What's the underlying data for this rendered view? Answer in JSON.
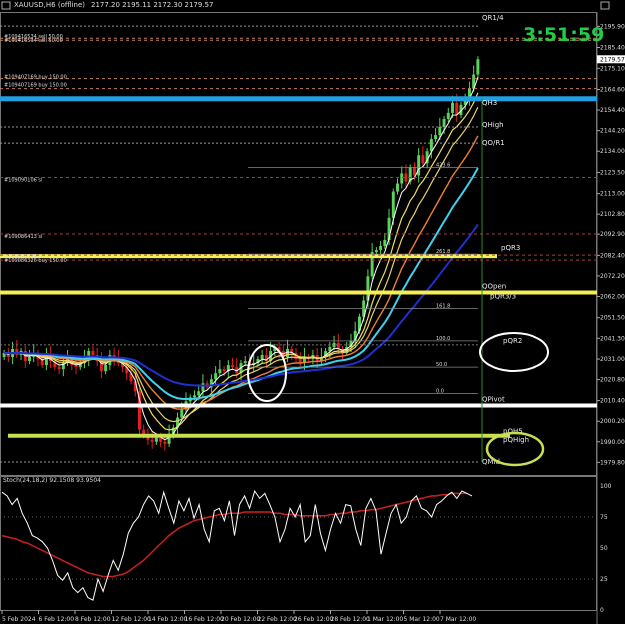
{
  "window": {
    "title": "XAUUSD,H6 (offline)",
    "ohlc": "2177.20 2195.11 2172.30 2179.57",
    "countdown": "3:51:59",
    "current_price_tag": "2179.57"
  },
  "colors": {
    "background": "#000000",
    "bull_candle": "#5ad35a",
    "bear_candle": "#e02020",
    "ema_fast": "#ffffff",
    "ema_yellow": "#f0e060",
    "ema_orange": "#f08030",
    "ema_cyan": "#40d0f0",
    "ema_blue": "#2030d0",
    "countdown": "#22cc44",
    "stoch_main": "#ffffff",
    "stoch_signal": "#cc2020"
  },
  "price_axis": {
    "ticks": [
      "2195.90",
      "2185.40",
      "2175.10",
      "2164.60",
      "2154.40",
      "2144.20",
      "2134.00",
      "2123.50",
      "2113.00",
      "2102.80",
      "2092.90",
      "2082.40",
      "2072.20",
      "2062.00",
      "2051.50",
      "2041.30",
      "2031.00",
      "2020.80",
      "2010.40",
      "2000.20",
      "1990.00",
      "1979.80"
    ]
  },
  "time_axis": {
    "ticks": [
      "5 Feb 2024",
      "6 Feb 12:00",
      "8 Feb 12:00",
      "12 Feb 12:00",
      "14 Feb 12:00",
      "16 Feb 12:00",
      "20 Feb 12:00",
      "22 Feb 12:00",
      "26 Feb 12:00",
      "28 Feb 12:00",
      "1 Mar 12:00",
      "5 Mar 12:00",
      "7 Mar 12:00"
    ]
  },
  "order_labels": [
    "#109416534 sell 50.00",
    "#109416534 sell 50.00",
    "#109407169 buy 150.00",
    "#109407169 buy 150.00",
    "#109090106 sl",
    "#109086413 sl",
    "#109086326 sl",
    "#109086326 buy 150.00"
  ],
  "level_labels": {
    "qr1": "QR1/4",
    "qh3": "QH3",
    "qhigh": "QHigh",
    "qor1": "QO/R1",
    "pqr3": "pQR3",
    "qopen": "QOpen",
    "pqr33": "pQR3/3",
    "pqr2": "pQR2",
    "qpivot": "QPivot",
    "pqh5": "pQH5",
    "pqhigh": "pQHigh",
    "qmid": "QMid"
  },
  "fib_labels": [
    "423.6",
    "261.8",
    "161.8",
    "100.0",
    "50.0",
    "0.0"
  ],
  "stoch": {
    "title": "Stoch(24,18,2) 92.1508 93.9504",
    "ticks": [
      "100",
      "75",
      "50",
      "25",
      "0"
    ]
  },
  "chart_data": [
    {
      "type": "candlestick",
      "title": "XAUUSD,H6 (offline)",
      "timeframe": "H6",
      "ylim": [
        1977,
        2203
      ],
      "x_ticks": [
        "5 Feb 2024",
        "6 Feb 12:00",
        "8 Feb 12:00",
        "12 Feb 12:00",
        "14 Feb 12:00",
        "16 Feb 12:00",
        "20 Feb 12:00",
        "22 Feb 12:00",
        "26 Feb 12:00",
        "28 Feb 12:00",
        "1 Mar 12:00",
        "5 Mar 12:00",
        "7 Mar 12:00"
      ],
      "close": [
        2034,
        2032,
        2036,
        2033,
        2035,
        2030,
        2032,
        2034,
        2031,
        2028,
        2033,
        2030,
        2027,
        2026,
        2029,
        2031,
        2028,
        2027,
        2029,
        2031,
        2035,
        2033,
        2030,
        2025,
        2028,
        2033,
        2031,
        2029,
        2027,
        2024,
        2020,
        2015,
        1996,
        1993,
        1991,
        1990,
        1992,
        1990,
        1989,
        1994,
        1997,
        2002,
        2006,
        2010,
        2012,
        2013,
        2015,
        2019,
        2017,
        2021,
        2024,
        2026,
        2025,
        2028,
        2027,
        2024,
        2029,
        2030,
        2028,
        2029,
        2031,
        2033,
        2030,
        2035,
        2037,
        2035,
        2032,
        2036,
        2034,
        2031,
        2029,
        2032,
        2031,
        2033,
        2030,
        2032,
        2035,
        2037,
        2039,
        2036,
        2034,
        2037,
        2040,
        2045,
        2052,
        2060,
        2072,
        2084,
        2085,
        2087,
        2090,
        2101,
        2114,
        2118,
        2123,
        2119,
        2126,
        2122,
        2132,
        2128,
        2134,
        2140,
        2142,
        2146,
        2150,
        2153,
        2158,
        2152,
        2157,
        2160,
        2165,
        2172,
        2179.57
      ],
      "price_levels": [
        {
          "name": "QR1/4",
          "value": 2196
        },
        {
          "name": "QH3",
          "value": 2160
        },
        {
          "name": "QHigh",
          "value": 2146
        },
        {
          "name": "QO/R1",
          "value": 2138
        },
        {
          "name": "pQR3",
          "value": 2082
        },
        {
          "name": "QOpen",
          "value": 2064
        },
        {
          "name": "pQR2",
          "value": 2038
        },
        {
          "name": "QPivot",
          "value": 2008
        },
        {
          "name": "pQH5",
          "value": 1993
        },
        {
          "name": "pQHigh",
          "value": 1990
        },
        {
          "name": "QMid",
          "value": 1980
        }
      ],
      "fib_levels": [
        {
          "label": "423.6",
          "value": 2126
        },
        {
          "label": "261.8",
          "value": 2083
        },
        {
          "label": "161.8",
          "value": 2056
        },
        {
          "label": "100.0",
          "value": 2040
        },
        {
          "label": "50.0",
          "value": 2027
        },
        {
          "label": "0.0",
          "value": 2014
        }
      ]
    },
    {
      "type": "line",
      "title": "Stoch(24,18,2) 92.1508 93.9504",
      "ylim": [
        0,
        100
      ],
      "y_ticks": [
        100,
        75,
        50,
        25,
        0
      ],
      "series": [
        {
          "name": "",
          "values": [
            95,
            92,
            85,
            90,
            78,
            70,
            60,
            58,
            55,
            50,
            40,
            28,
            24,
            30,
            18,
            14,
            18,
            10,
            8,
            25,
            15,
            28,
            40,
            32,
            45,
            62,
            70,
            75,
            85,
            92,
            88,
            78,
            95,
            82,
            70,
            88,
            80,
            90,
            74,
            85,
            65,
            55,
            80,
            82,
            72,
            88,
            60,
            85,
            92,
            82,
            96,
            90,
            94,
            85,
            75,
            55,
            65,
            82,
            75,
            85,
            55,
            60,
            85,
            62,
            48,
            65,
            78,
            70,
            85,
            84,
            65,
            52,
            82,
            90,
            80,
            45,
            62,
            78,
            85,
            70,
            75,
            88,
            92,
            82,
            80,
            75,
            85,
            88,
            92,
            95,
            90,
            96,
            94,
            92
          ]
        },
        {
          "name": "",
          "values": [
            60,
            59,
            58,
            57,
            55,
            54,
            52,
            50,
            48,
            46,
            44,
            42,
            40,
            38,
            36,
            34,
            32,
            30,
            29,
            28,
            27,
            27,
            27,
            28,
            29,
            31,
            34,
            37,
            40,
            44,
            48,
            52,
            56,
            60,
            63,
            66,
            68,
            70,
            72,
            73,
            74,
            75,
            76,
            77,
            77,
            78,
            78,
            78,
            79,
            79,
            79,
            79,
            79,
            79,
            78,
            78,
            77,
            77,
            77,
            76,
            76,
            76,
            76,
            76,
            76,
            77,
            77,
            78,
            78,
            79,
            79,
            80,
            80,
            81,
            81,
            82,
            83,
            84,
            85,
            86,
            87,
            88,
            89,
            90,
            91,
            92,
            92,
            93,
            93,
            94,
            94,
            94,
            94
          ]
        }
      ]
    }
  ]
}
